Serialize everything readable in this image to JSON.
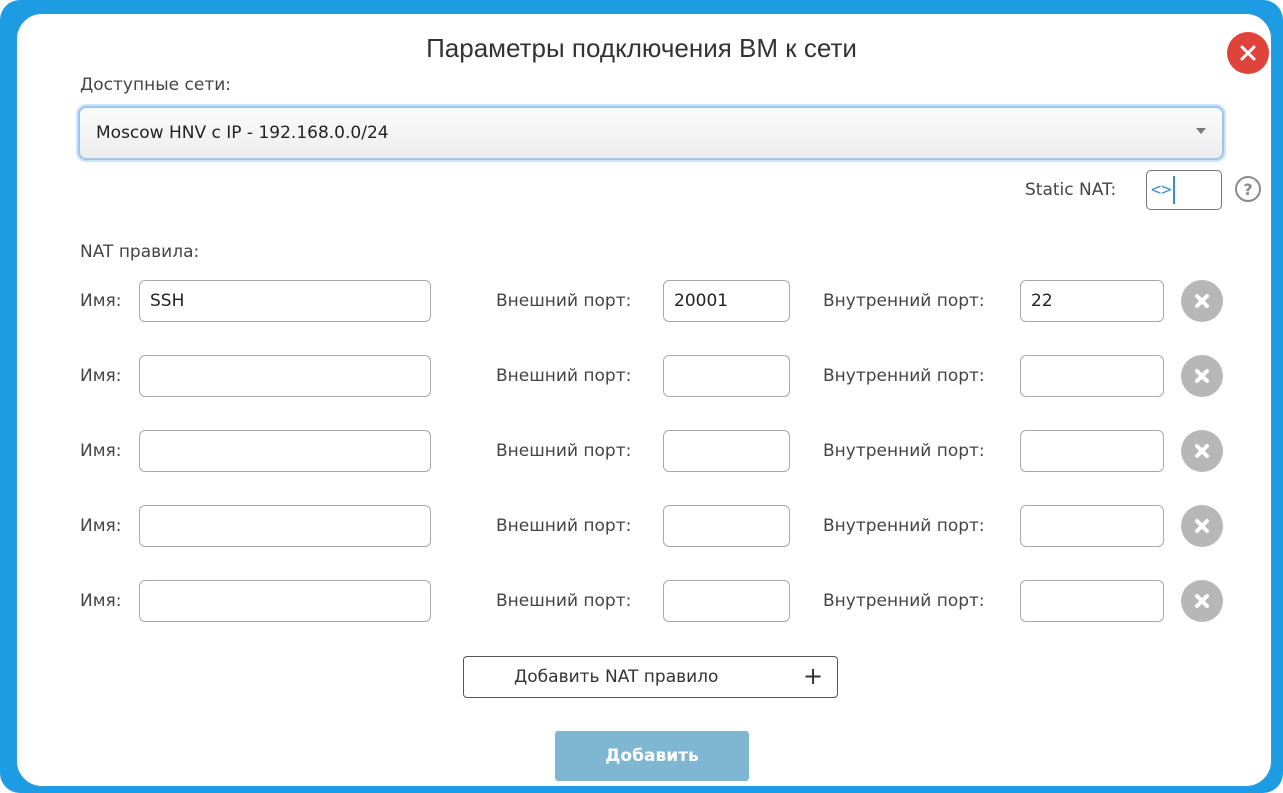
{
  "dialog": {
    "title": "Параметры подключения ВМ к сети"
  },
  "networks": {
    "label": "Доступные сети:",
    "selected": "Moscow HNV с IP - 192.168.0.0/24"
  },
  "static_nat": {
    "label": "Static NAT:",
    "value": "<>",
    "help_symbol": "?"
  },
  "nat_rules": {
    "label": "NAT правила:",
    "name_label": "Имя:",
    "external_label": "Внешний порт:",
    "internal_label": "Внутренний порт:",
    "rows": [
      {
        "name": "SSH",
        "external": "20001",
        "internal": "22"
      },
      {
        "name": "",
        "external": "",
        "internal": ""
      },
      {
        "name": "",
        "external": "",
        "internal": ""
      },
      {
        "name": "",
        "external": "",
        "internal": ""
      },
      {
        "name": "",
        "external": "",
        "internal": ""
      }
    ]
  },
  "buttons": {
    "add_rule": "Добавить NAT правило",
    "add_rule_icon": "+",
    "submit": "Добавить"
  },
  "colors": {
    "frame": "#1d9be3",
    "close": "#e0433b",
    "remove": "#b7b7b7",
    "submit": "#7fb7d3"
  },
  "icons": {
    "close": "close-icon",
    "remove": "remove-row-icon",
    "help": "help-icon",
    "dropdown": "chevron-down-icon",
    "add": "plus-icon"
  }
}
